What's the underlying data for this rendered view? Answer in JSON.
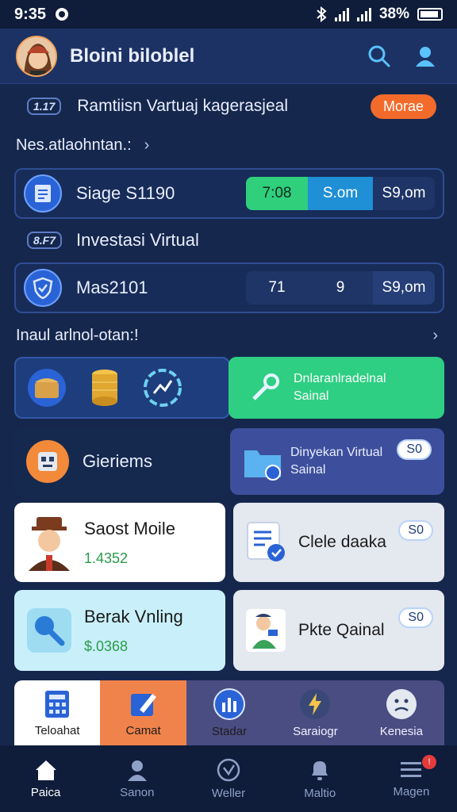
{
  "status": {
    "time": "9:35",
    "battery": "38%"
  },
  "header": {
    "title": "Bloini biloblel"
  },
  "banner": {
    "badge": "1.17",
    "text": "Ramtiisn Vartuaj kagerasjeal",
    "button": "Morae"
  },
  "section1": {
    "title": "Nes.atlaohntan.:"
  },
  "row1": {
    "label": "Siage S1190",
    "seg": [
      "7:08",
      "S.om",
      "S9,om"
    ]
  },
  "subsection": {
    "badge": "8.F7",
    "title": "Investasi Virtual"
  },
  "row2": {
    "label": "Mas2101",
    "seg": [
      "71",
      "9",
      "S9,om"
    ]
  },
  "section2": {
    "title": "Inaul arlnol-otan:!"
  },
  "tileGreen": {
    "line1": "Dnlaranlradelnal",
    "line2": "Sainal"
  },
  "tileGiem": {
    "label": "Gieriems"
  },
  "tileVirtual": {
    "line1": "Dinyekan Virtual",
    "line2": "Sainal",
    "pill": "S0"
  },
  "tileSaost": {
    "title": "Saost Moile",
    "value": "1.4352"
  },
  "tileClele": {
    "title": "Clele daaka",
    "pill": "S0"
  },
  "tileBerak": {
    "title": "Berak Vnling",
    "value": "$.0368"
  },
  "tilePkte": {
    "title": "Pkte Qainal",
    "pill": "S0"
  },
  "dock": [
    "Teloahat",
    "Camat",
    "Stadar",
    "Saraiogr",
    "Kenesia"
  ],
  "tabs": [
    "Paica",
    "Sanon",
    "Weller",
    "Maltio",
    "Magen"
  ],
  "colors": {
    "accent": "#f26b2b",
    "green": "#2ecf82",
    "blue": "#1f8fd6",
    "bg": "#16274d"
  }
}
